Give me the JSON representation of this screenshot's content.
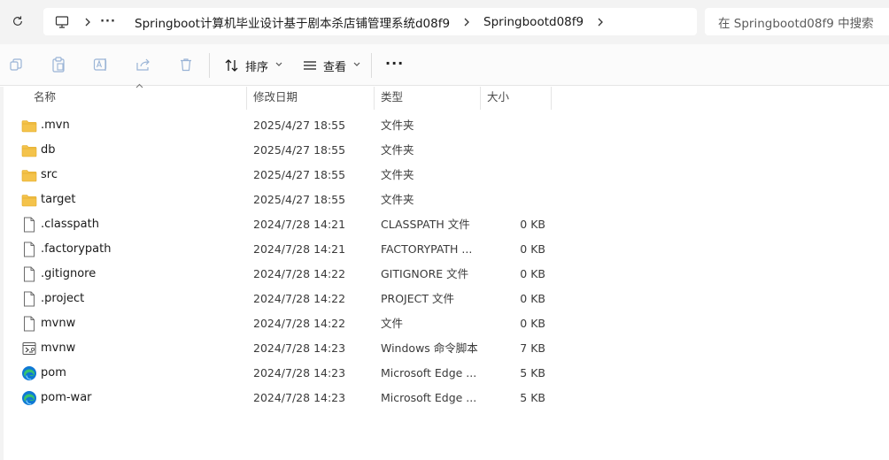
{
  "breadcrumb": {
    "more": "···",
    "items": [
      "Springboot计算机毕业设计基于剧本杀店铺管理系统d08f9",
      "Springbootd08f9"
    ]
  },
  "search": {
    "placeholder": "在 Springbootd08f9 中搜索"
  },
  "toolbar": {
    "sort_label": "排序",
    "view_label": "查看",
    "more": "···",
    "icons": [
      "copy-icon",
      "paste-icon",
      "rename-icon",
      "share-icon",
      "delete-icon"
    ]
  },
  "columns": {
    "name": "名称",
    "date": "修改日期",
    "type": "类型",
    "size": "大小"
  },
  "files": [
    {
      "name": ".mvn",
      "date": "2025/4/27 18:55",
      "type": "文件夹",
      "size": "",
      "icon": "folder"
    },
    {
      "name": "db",
      "date": "2025/4/27 18:55",
      "type": "文件夹",
      "size": "",
      "icon": "folder"
    },
    {
      "name": "src",
      "date": "2025/4/27 18:55",
      "type": "文件夹",
      "size": "",
      "icon": "folder"
    },
    {
      "name": "target",
      "date": "2025/4/27 18:55",
      "type": "文件夹",
      "size": "",
      "icon": "folder"
    },
    {
      "name": ".classpath",
      "date": "2024/7/28 14:21",
      "type": "CLASSPATH 文件",
      "size": "0 KB",
      "icon": "file"
    },
    {
      "name": ".factorypath",
      "date": "2024/7/28 14:21",
      "type": "FACTORYPATH ...",
      "size": "0 KB",
      "icon": "file"
    },
    {
      "name": ".gitignore",
      "date": "2024/7/28 14:22",
      "type": "GITIGNORE 文件",
      "size": "0 KB",
      "icon": "file"
    },
    {
      "name": ".project",
      "date": "2024/7/28 14:22",
      "type": "PROJECT 文件",
      "size": "0 KB",
      "icon": "file"
    },
    {
      "name": "mvnw",
      "date": "2024/7/28 14:22",
      "type": "文件",
      "size": "0 KB",
      "icon": "file"
    },
    {
      "name": "mvnw",
      "date": "2024/7/28 14:23",
      "type": "Windows 命令脚本",
      "size": "7 KB",
      "icon": "script"
    },
    {
      "name": "pom",
      "date": "2024/7/28 14:23",
      "type": "Microsoft Edge ...",
      "size": "5 KB",
      "icon": "edge"
    },
    {
      "name": "pom-war",
      "date": "2024/7/28 14:23",
      "type": "Microsoft Edge ...",
      "size": "5 KB",
      "icon": "edge"
    }
  ],
  "colors": {
    "folder": "#f4c34b",
    "folder_dark": "#e0a92a",
    "edge_blue": "#0f78d4",
    "edge_green": "#37c36e"
  }
}
